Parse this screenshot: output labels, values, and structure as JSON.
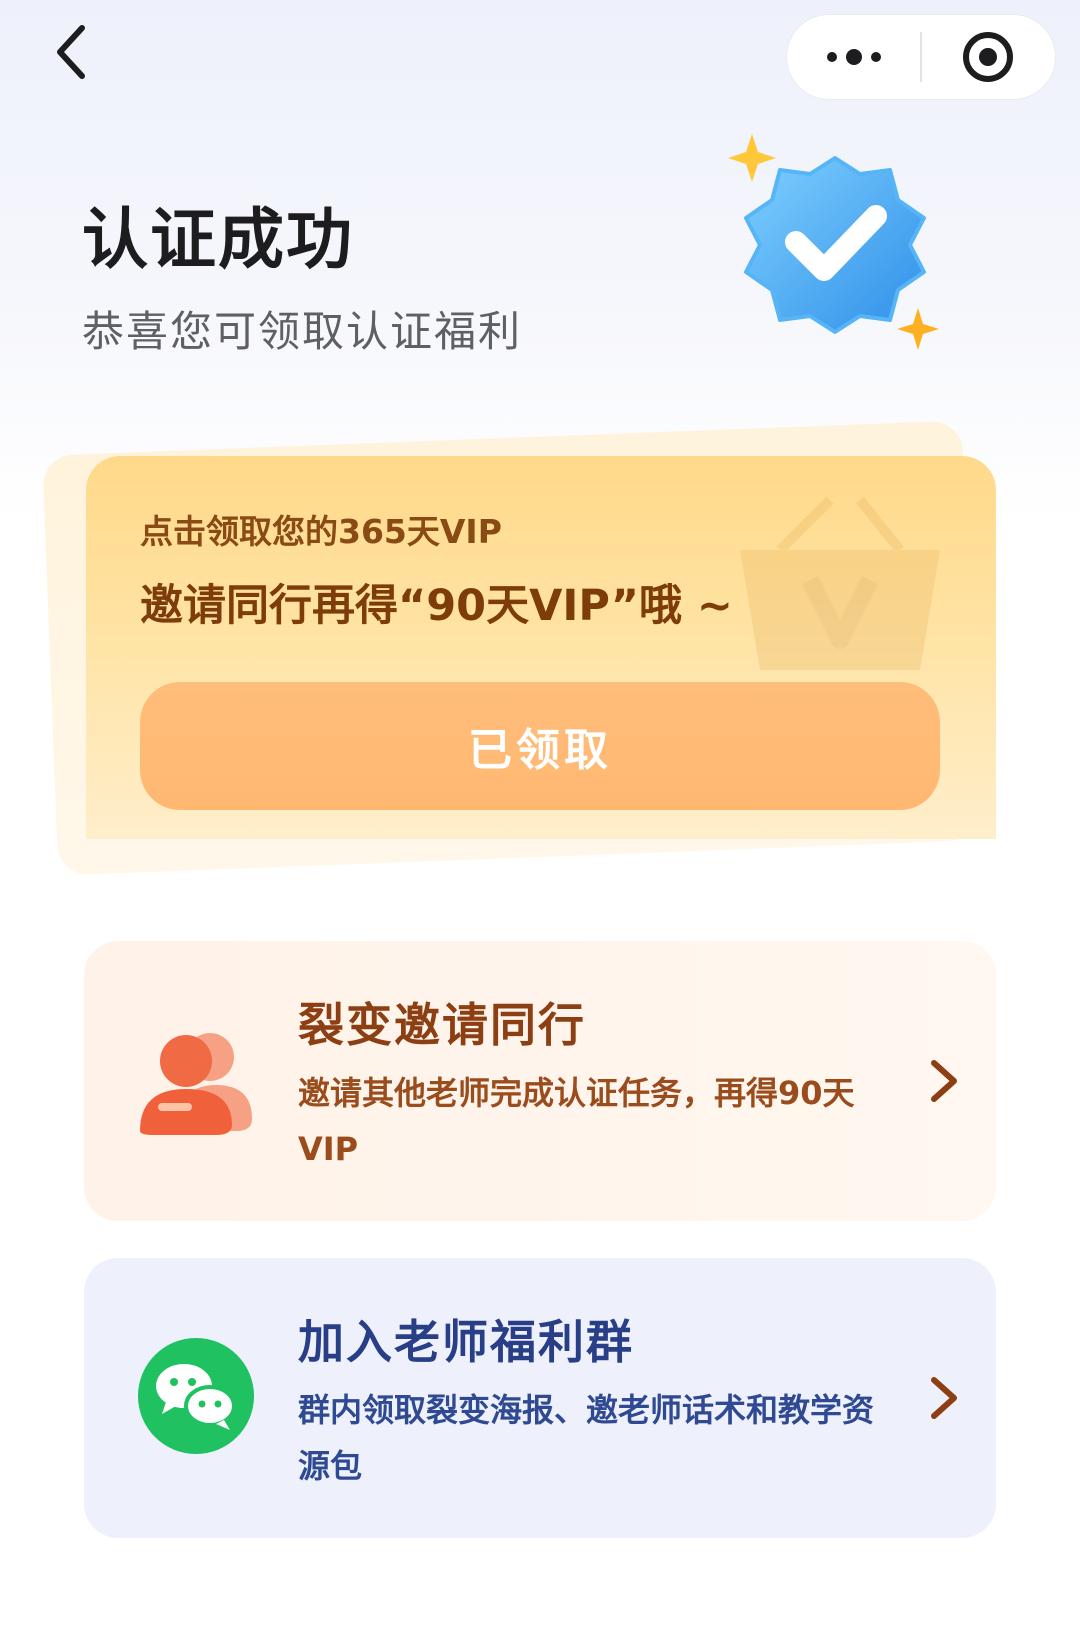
{
  "header": {
    "back_icon": "chevron-left-icon",
    "more_icon": "more-dots-icon",
    "close_icon": "target-circle-icon"
  },
  "hero": {
    "title": "认证成功",
    "subtitle": "恭喜您可领取认证福利",
    "badge_icon": "verified-badge-icon",
    "badge_color": "#3aa5f2"
  },
  "vip_card": {
    "line1": "点击领取您的365天VIP",
    "line2": "邀请同行再得“90天VIP”哦 ~",
    "button_label": "已领取",
    "button_color": "#ffb872"
  },
  "options": [
    {
      "title": "裂变邀请同行",
      "description": "邀请其他老师完成认证任务，再得90天VIP",
      "icon": "people-icon",
      "accent": "#f0603a"
    },
    {
      "title": "加入老师福利群",
      "description": "群内领取裂变海报、邀老师话术和教学资源包",
      "icon": "wechat-icon",
      "accent": "#1fc160"
    }
  ]
}
